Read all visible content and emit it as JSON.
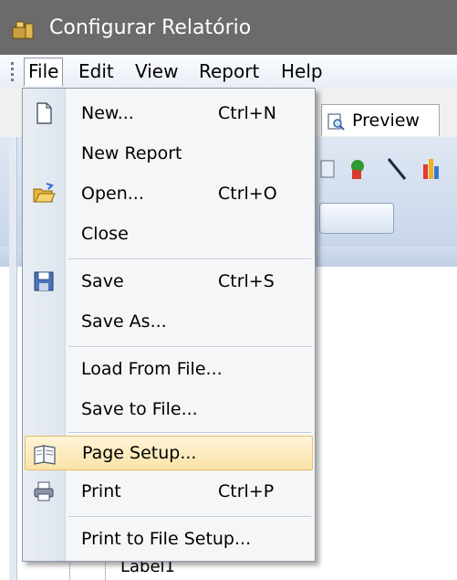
{
  "window": {
    "title": "Configurar Relatório"
  },
  "menubar": {
    "items": [
      {
        "label": "File"
      },
      {
        "label": "Edit"
      },
      {
        "label": "View"
      },
      {
        "label": "Report"
      },
      {
        "label": "Help"
      }
    ]
  },
  "toolbar": {
    "preview_label": "Preview"
  },
  "tree": {
    "partial_label": "Label1"
  },
  "file_menu": {
    "new_label": "New...",
    "new_shortcut": "Ctrl+N",
    "new_report_label": "New Report",
    "open_label": "Open...",
    "open_shortcut": "Ctrl+O",
    "close_label": "Close",
    "save_label": "Save",
    "save_shortcut": "Ctrl+S",
    "save_as_label": "Save As...",
    "load_label": "Load From File...",
    "save_to_file_label": "Save to File...",
    "page_setup_label": "Page Setup...",
    "print_label": "Print",
    "print_shortcut": "Ctrl+P",
    "print_to_file_label": "Print to File Setup..."
  },
  "colors": {
    "highlight": "#fbe3a8",
    "titlebar": "#6b6b6b"
  }
}
